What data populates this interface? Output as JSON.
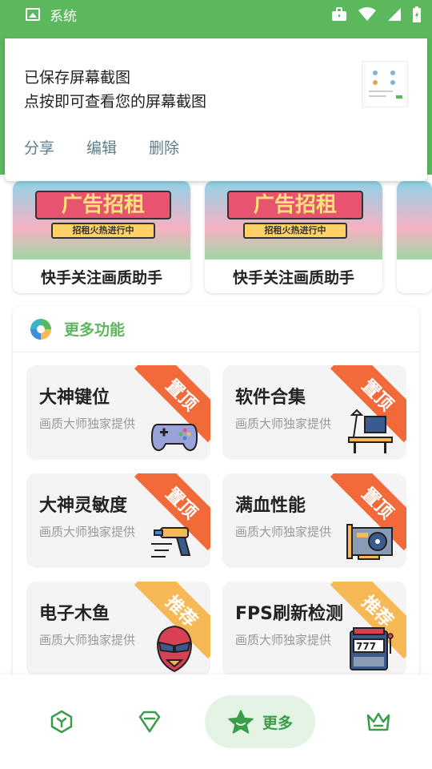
{
  "status_bar": {
    "app_name": "系统",
    "icons": [
      "image-icon",
      "briefcase-icon",
      "wifi-icon",
      "signal-icon",
      "battery-icon"
    ]
  },
  "notification": {
    "line1": "已保存屏幕截图",
    "line2": "点按即可查看您的屏幕截图",
    "actions": {
      "share": "分享",
      "edit": "编辑",
      "delete": "删除"
    }
  },
  "banners": [
    {
      "caption": "快手关注画质助手",
      "ad_title": "广告招租",
      "ad_sub": "招租火热进行中"
    },
    {
      "caption": "快手关注画质助手",
      "ad_title": "广告招租",
      "ad_sub": "招租火热进行中"
    }
  ],
  "more": {
    "title": "更多功能",
    "tiles": [
      {
        "title": "大神键位",
        "subtitle": "画质大师独家提供",
        "badge": "置顶",
        "badge_color": "#f26a3a",
        "icon": "gamepad-icon"
      },
      {
        "title": "软件合集",
        "subtitle": "画质大师独家提供",
        "badge": "置顶",
        "badge_color": "#f26a3a",
        "icon": "desk-lamp-icon"
      },
      {
        "title": "大神灵敏度",
        "subtitle": "画质大师独家提供",
        "badge": "置顶",
        "badge_color": "#f26a3a",
        "icon": "blaster-icon"
      },
      {
        "title": "满血性能",
        "subtitle": "画质大师独家提供",
        "badge": "置顶",
        "badge_color": "#f26a3a",
        "icon": "graphics-card-icon"
      },
      {
        "title": "电子木鱼",
        "subtitle": "画质大师独家提供",
        "badge": "推荐",
        "badge_color": "#f7b955",
        "icon": "superhero-mask-icon"
      },
      {
        "title": "FPS刷新检测",
        "subtitle": "画质大师独家提供",
        "badge": "推荐",
        "badge_color": "#f7b955",
        "icon": "slot-machine-icon"
      }
    ]
  },
  "bottom_nav": {
    "active_label": "更多"
  },
  "colors": {
    "brand_green": "#5cb85c",
    "accent_text": "#3a9d4a",
    "action_text": "#5d7d8a"
  }
}
